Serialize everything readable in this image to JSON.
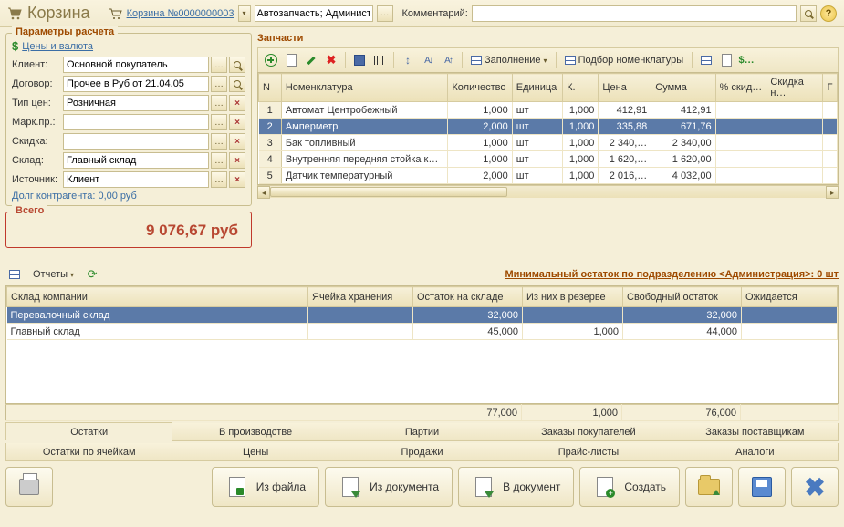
{
  "header": {
    "title": "Корзина",
    "doc_label": "Корзина №0000000003",
    "context": "Автозапчасть; Админист …",
    "comment_label": "Комментарий:",
    "comment_value": ""
  },
  "params": {
    "title": "Параметры расчета",
    "prices_link": "Цены и валюта",
    "rows": {
      "client_label": "Клиент:",
      "client": "Основной покупатель",
      "contract_label": "Договор:",
      "contract": "Прочее в Руб от 21.04.05",
      "ptype_label": "Тип цен:",
      "ptype": "Розничная",
      "brand_label": "Марк.пр.:",
      "brand": "",
      "discount_label": "Скидка:",
      "discount": "",
      "warehouse_label": "Склад:",
      "warehouse": "Главный склад",
      "source_label": "Источник:",
      "source": "Клиент"
    },
    "debt_link": "Долг контрагента: 0,00 руб"
  },
  "total": {
    "title": "Всего",
    "value": "9 076,67 руб"
  },
  "parts": {
    "title": "Запчасти",
    "toolbar": {
      "fill": "Заполнение",
      "pick": "Подбор номенклатуры"
    },
    "columns": [
      "N",
      "Номенклатура",
      "Количество",
      "Единица",
      "К.",
      "Цена",
      "Сумма",
      "% скид…",
      "Скидка н…",
      "Г"
    ],
    "rows": [
      {
        "n": "1",
        "nom": "Автомат Центробежный",
        "qty": "1,000",
        "unit": "шт",
        "k": "1,000",
        "price": "412,91",
        "sum": "412,91"
      },
      {
        "n": "2",
        "nom": "Амперметр",
        "qty": "2,000",
        "unit": "шт",
        "k": "1,000",
        "price": "335,88",
        "sum": "671,76",
        "selected": true
      },
      {
        "n": "3",
        "nom": "Бак топливный",
        "qty": "1,000",
        "unit": "шт",
        "k": "1,000",
        "price": "2 340,…",
        "sum": "2 340,00"
      },
      {
        "n": "4",
        "nom": "Внутренняя передняя стойка к…",
        "qty": "1,000",
        "unit": "шт",
        "k": "1,000",
        "price": "1 620,…",
        "sum": "1 620,00"
      },
      {
        "n": "5",
        "nom": "Датчик температурный",
        "qty": "2,000",
        "unit": "шт",
        "k": "1,000",
        "price": "2 016,…",
        "sum": "4 032,00"
      }
    ]
  },
  "reports": {
    "dropdown": "Отчеты",
    "headline": "Минимальный остаток по подразделению <Администрация>: 0 шт",
    "columns": [
      "Склад компании",
      "Ячейка хранения",
      "Остаток на складе",
      "Из них в резерве",
      "Свободный остаток",
      "Ожидается"
    ],
    "rows": [
      {
        "name": "Перевалочный склад",
        "cell": "",
        "stock": "32,000",
        "reserve": "",
        "free": "32,000",
        "expected": "",
        "selected": true
      },
      {
        "name": "Главный склад",
        "cell": "",
        "stock": "45,000",
        "reserve": "1,000",
        "free": "44,000",
        "expected": ""
      }
    ],
    "footer": {
      "stock": "77,000",
      "reserve": "1,000",
      "free": "76,000"
    }
  },
  "tabs1": [
    "Остатки",
    "В производстве",
    "Партии",
    "Заказы покупателей",
    "Заказы поставщикам"
  ],
  "tabs2": [
    "Остатки по ячейкам",
    "Цены",
    "Продажи",
    "Прайс-листы",
    "Аналоги"
  ],
  "actions": {
    "from_file": "Из файла",
    "from_doc": "Из документа",
    "to_doc": "В документ",
    "create": "Создать"
  }
}
